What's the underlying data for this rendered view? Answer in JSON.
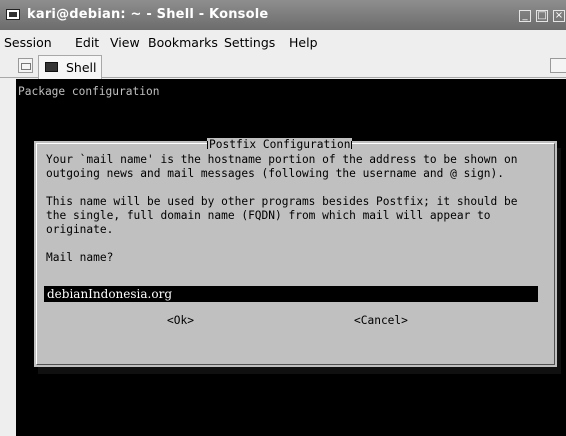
{
  "window": {
    "title": "kari@debian: ~ - Shell - Konsole",
    "minimize_glyph": "_",
    "maximize_glyph": "□",
    "close_glyph": "×"
  },
  "menu": [
    "Session",
    "Edit",
    "View",
    "Bookmarks",
    "Settings",
    "Help"
  ],
  "tabs": {
    "active_label": "Shell"
  },
  "terminal": {
    "header": "Package configuration",
    "dialog": {
      "title": "Postfix Configuration",
      "body": "Your `mail name' is the hostname portion of the address to be shown on\noutgoing news and mail messages (following the username and @ sign).\n\nThis name will be used by other programs besides Postfix; it should be\nthe single, full domain name (FQDN) from which mail will appear to\noriginate.\n\nMail name?",
      "input_value": "debianIndonesia.org",
      "ok_button": "<Ok>",
      "cancel_button": "<Cancel>"
    }
  },
  "colors": {
    "titlebar": "#7a7a7a",
    "terminal_bg": "#000000",
    "terminal_fg": "#c0c0c0",
    "dialog_bg": "#c0c0c0"
  }
}
